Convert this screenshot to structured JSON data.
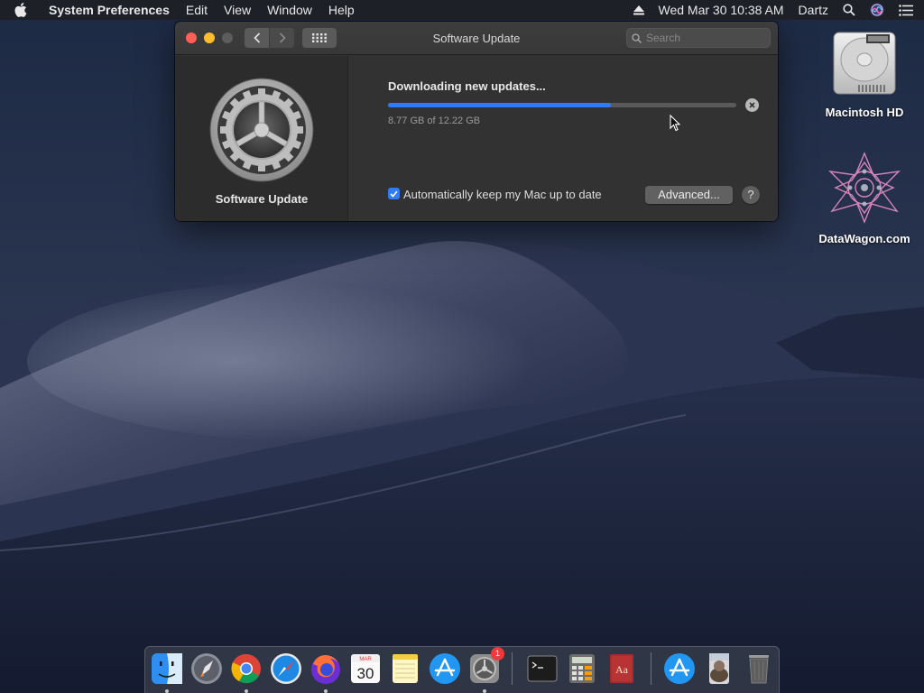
{
  "menubar": {
    "app_name": "System Preferences",
    "menus": [
      "Edit",
      "View",
      "Window",
      "Help"
    ],
    "datetime": "Wed Mar 30  10:38 AM",
    "user": "Dartz"
  },
  "window": {
    "title": "Software Update",
    "search_placeholder": "Search",
    "pane_label": "Software Update",
    "status_title": "Downloading new updates...",
    "progress_fraction": 0.64,
    "size_text": "8.77 GB of 12.22 GB",
    "auto_update_label": "Automatically keep my Mac up to date",
    "auto_update_checked": true,
    "advanced_label": "Advanced...",
    "help_label": "?"
  },
  "desktop": {
    "icons": [
      {
        "label": "Macintosh HD",
        "icon": "hard-drive-icon"
      },
      {
        "label": "DataWagon.com",
        "icon": "datawagon-logo-icon"
      }
    ]
  },
  "dock": {
    "calendar_month": "MAR",
    "calendar_day": "30",
    "sysprefs_badge": "1",
    "items": [
      "finder",
      "launchpad",
      "chrome",
      "safari",
      "firefox",
      "calendar",
      "notes",
      "app-store",
      "system-preferences",
      "terminal",
      "calculator",
      "dictionary",
      "app-store-downloads",
      "photo-preview",
      "trash"
    ]
  },
  "colors": {
    "accent": "#2f7cf6",
    "window_bg": "#323232",
    "close": "#fe5f57",
    "minimize": "#febc2e"
  }
}
